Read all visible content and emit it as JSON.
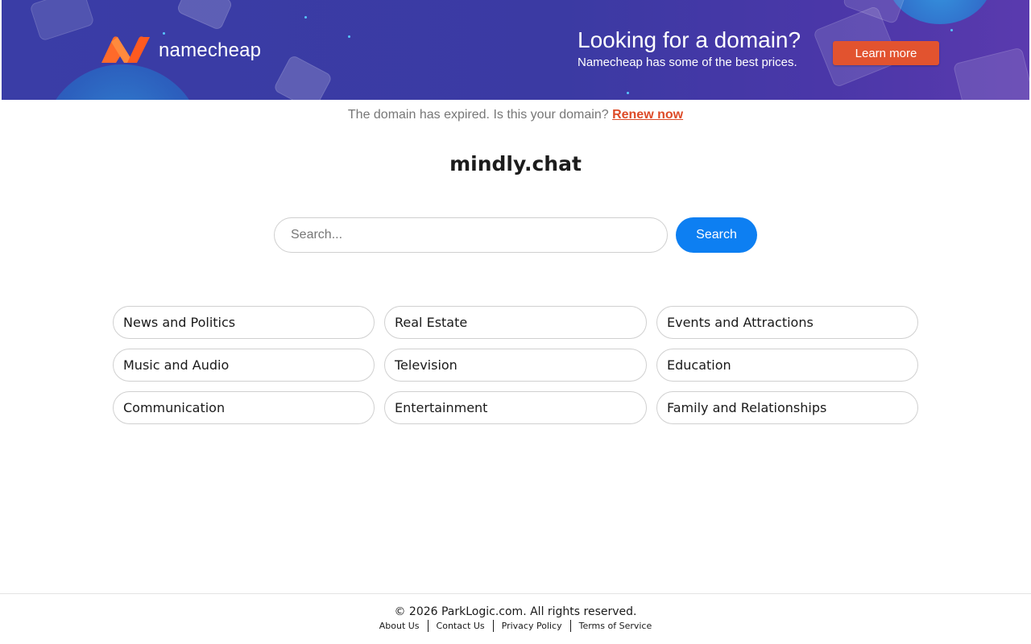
{
  "banner": {
    "brand_name": "namecheap",
    "logo_icon": "namecheap-logo-icon",
    "promo_title": "Looking for a domain?",
    "promo_subtitle": "Namecheap has some of the best prices.",
    "cta_label": "Learn more",
    "colors": {
      "background": "#3a3da6",
      "cta": "#e2532f",
      "logo_orange": "#ff6a2a"
    }
  },
  "notice": {
    "text": "The domain has expired. Is this your domain?",
    "link_label": "Renew now",
    "link_color": "#dd4b28"
  },
  "domain": {
    "name": "mindly.chat"
  },
  "search": {
    "placeholder": "Search...",
    "value": "",
    "button_label": "Search",
    "button_color": "#0d7ff2"
  },
  "categories": [
    {
      "label": "News and Politics"
    },
    {
      "label": "Real Estate"
    },
    {
      "label": "Events and Attractions"
    },
    {
      "label": "Music and Audio"
    },
    {
      "label": "Television"
    },
    {
      "label": "Education"
    },
    {
      "label": "Communication"
    },
    {
      "label": "Entertainment"
    },
    {
      "label": "Family and Relationships"
    }
  ],
  "footer": {
    "copyright": "© 2026 ParkLogic.com. All rights reserved.",
    "links": [
      {
        "label": "About Us"
      },
      {
        "label": "Contact Us"
      },
      {
        "label": "Privacy Policy"
      },
      {
        "label": "Terms of Service"
      }
    ]
  }
}
